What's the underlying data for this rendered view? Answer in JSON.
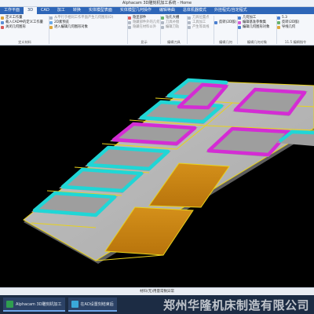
{
  "window": {
    "title": "Alphacam 3D雕刻机加工系统 - Home"
  },
  "tabs": [
    {
      "label": "工作平面"
    },
    {
      "label": "3D"
    },
    {
      "label": "CAD"
    },
    {
      "label": "加工"
    },
    {
      "label": "转换"
    },
    {
      "label": "实体模型表面"
    },
    {
      "label": "实体模型几何操作"
    },
    {
      "label": "编辑等曲"
    },
    {
      "label": "总体机器模式"
    },
    {
      "label": "外挂程式/自定程式"
    }
  ],
  "ribbon": {
    "group1": {
      "items": [
        "定义工作量",
        "载入CAD中的定义工作量",
        "关闭几何图形",
        "定义材料"
      ],
      "label": "定义材料"
    },
    "group2": {
      "items": [
        "从平行于相同工作平面产生几何图形(D)",
        "2D素预览",
        "进入编辑几何图形对象"
      ]
    },
    "group3": {
      "items": [
        "隐显部件",
        "隐藏部件外的几何",
        "隐藏在材料以外"
      ],
      "label": "显示"
    },
    "group4": {
      "items": [
        "钻孔大槽",
        "刀具补偿",
        "编辑刀轨"
      ],
      "label": "编辑刀具"
    },
    "group5": {
      "items": [
        "刀具位置点",
        "工具加工",
        "产生等高线"
      ]
    },
    "group6": {
      "items": [
        "反转(2D版)"
      ],
      "label": "编辑几何"
    },
    "group7": {
      "items": [
        "几何加工",
        "编辑基准参数集",
        "编辑几何图形对象"
      ],
      "label": "编辑几何对象"
    },
    "group8": {
      "items": [
        "5.3",
        "反转(2D版)",
        "导线几何",
        "设定其加工"
      ],
      "label": "5轴加工"
    },
    "group9": {
      "items": [
        "11.5 编辑指令"
      ],
      "label": "编辑指令"
    }
  },
  "statusbar": {
    "text": "材料(无)用量常数异常"
  },
  "taskbar": {
    "items": [
      {
        "label": "Alphacam 3D雕刻机加工"
      },
      {
        "label": "在AD设置刻结束后"
      }
    ]
  },
  "watermark": {
    "text": "郑州华隆机床制造有限公司"
  },
  "colors": {
    "ribbon_tab_bar": "#2e66b8",
    "sheet": "#b5b5b5",
    "frame_line": "#e8d21c",
    "pocket_wall_cyan": "#20d6d6",
    "pocket_wall_magenta": "#d42cd4",
    "filled_panel": "#cc8410"
  }
}
